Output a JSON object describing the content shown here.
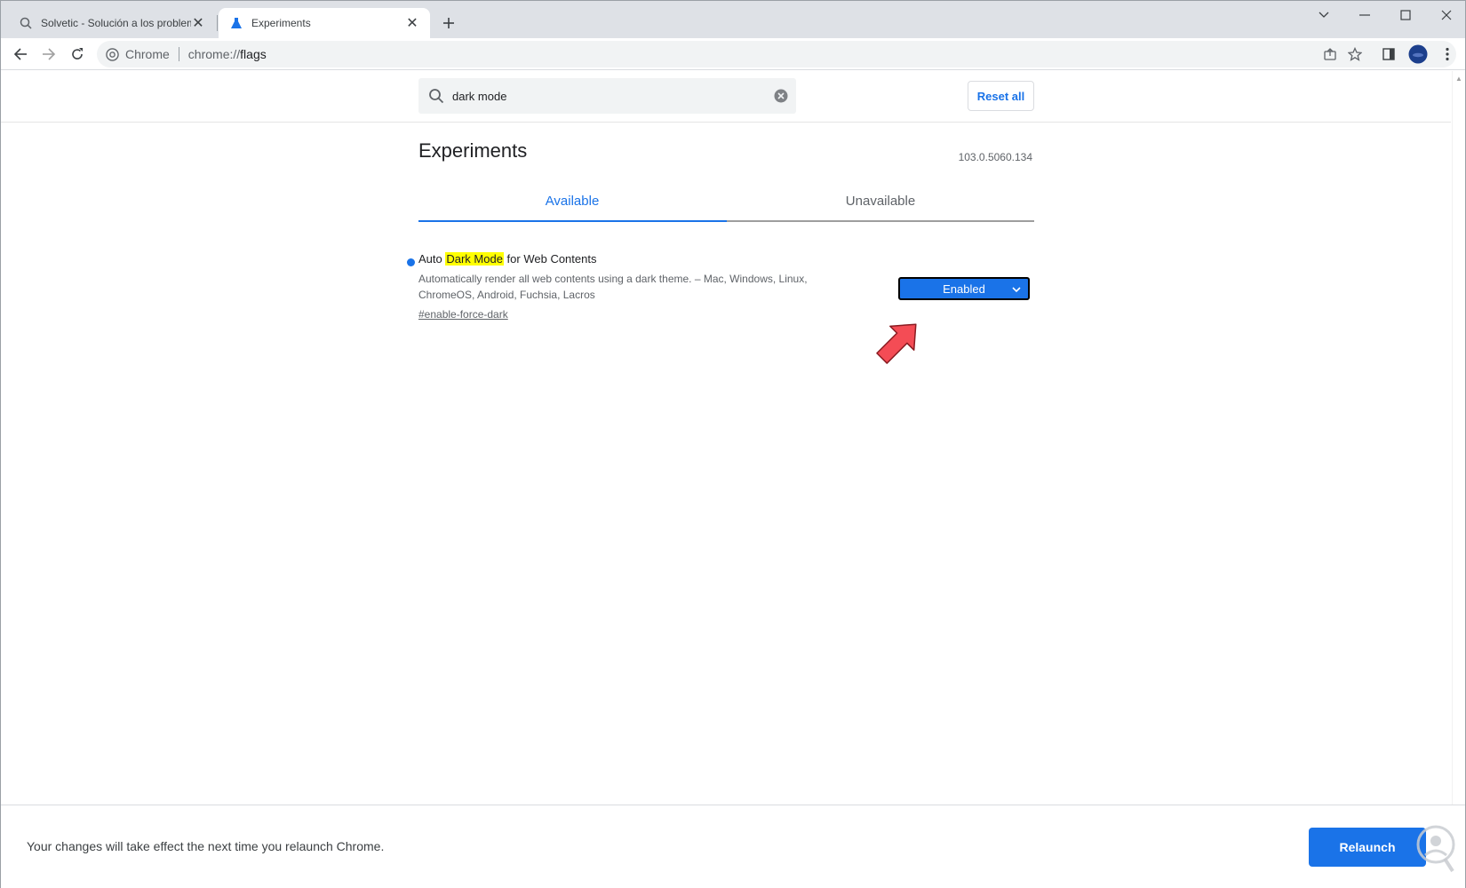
{
  "tabs": [
    {
      "title": "Solvetic - Solución a los problem",
      "active": false
    },
    {
      "title": "Experiments",
      "active": true
    }
  ],
  "omnibox": {
    "chip_label": "Chrome",
    "url_scheme": "chrome://",
    "url_host": "flags"
  },
  "flags": {
    "search_value": "dark mode",
    "reset_label": "Reset all",
    "title": "Experiments",
    "version": "103.0.5060.134",
    "tab_available": "Available",
    "tab_unavailable": "Unavailable",
    "experiment": {
      "name_prefix": "Auto ",
      "name_highlight": "Dark Mode",
      "name_suffix": " for Web Contents",
      "description": "Automatically render all web contents using a dark theme. – Mac, Windows, Linux, ChromeOS, Android, Fuchsia, Lacros",
      "link": "#enable-force-dark",
      "selected_option": "Enabled"
    }
  },
  "bottom": {
    "message": "Your changes will take effect the next time you relaunch Chrome.",
    "relaunch_label": "Relaunch"
  },
  "colors": {
    "accent": "#1a73e8",
    "highlight": "#ffff00",
    "arrow": "#f44c55"
  },
  "icons": [
    "search-icon",
    "flask-icon",
    "close-icon",
    "plus-icon",
    "back-icon",
    "forward-icon",
    "reload-icon",
    "chrome-logo-icon",
    "share-icon",
    "star-icon",
    "side-panel-icon",
    "profile-avatar-icon",
    "menu-icon",
    "minimize-icon",
    "maximize-icon",
    "window-close-icon",
    "clear-icon",
    "chevron-down-icon"
  ]
}
